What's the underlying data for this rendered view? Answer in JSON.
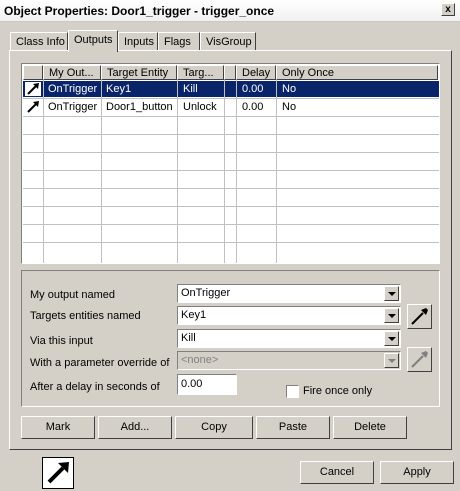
{
  "window": {
    "title": "Object Properties: Door1_trigger - trigger_once",
    "close_label": "x"
  },
  "tabs": [
    "Class Info",
    "Outputs",
    "Inputs",
    "Flags",
    "VisGroup"
  ],
  "active_tab": "Outputs",
  "outputs_table": {
    "columns": [
      "My Out...",
      "Target Entity",
      "Targ...",
      "Delay",
      "Only Once"
    ],
    "rows": [
      {
        "output": "OnTrigger",
        "target": "Key1",
        "input": "Kill",
        "delay": "0.00",
        "only_once": "No",
        "selected": true
      },
      {
        "output": "OnTrigger",
        "target": "Door1_button",
        "input": "Unlock",
        "delay": "0.00",
        "only_once": "No",
        "selected": false
      }
    ]
  },
  "form": {
    "output_label": "My output named",
    "output_value": "OnTrigger",
    "targets_label": "Targets entities named",
    "targets_value": "Key1",
    "input_label": "Via this input",
    "input_value": "Kill",
    "param_label": "With a parameter override of",
    "param_value": "<none>",
    "delay_label": "After a delay in seconds of",
    "delay_value": "0.00",
    "fire_once_label": "Fire once only"
  },
  "buttons": {
    "mark": "Mark",
    "add": "Add...",
    "copy": "Copy",
    "paste": "Paste",
    "delete": "Delete"
  },
  "footer": {
    "cancel": "Cancel",
    "apply": "Apply"
  },
  "icons": {
    "row_icon": "output-arrow-icon",
    "picker": "eyedropper-icon",
    "big": "output-arrow-icon"
  },
  "colors": {
    "selection": "#0a246a",
    "face": "#d4d0c8"
  }
}
